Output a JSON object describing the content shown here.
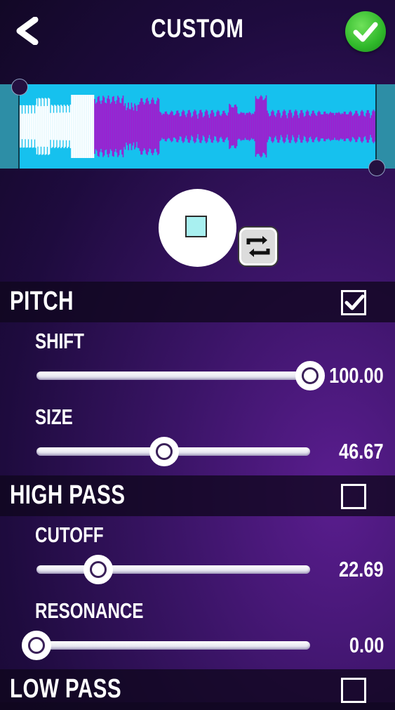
{
  "header": {
    "title": "CUSTOM",
    "back_icon": "back-arrow-icon",
    "confirm_icon": "checkmark-icon"
  },
  "waveform": {
    "background": "#16c1ee",
    "trim_color": "#2d8ea6",
    "played_color": "#ffffff",
    "selected_color": "#9b1fd0"
  },
  "player": {
    "state": "playing",
    "stop_icon": "stop-icon",
    "loop_icon": "repeat-icon"
  },
  "sections": {
    "pitch": {
      "title": "PITCH",
      "enabled": true,
      "params": [
        {
          "label": "SHIFT",
          "value": "100.00",
          "fraction": 1.0
        },
        {
          "label": "SIZE",
          "value": "46.67",
          "fraction": 0.4667
        }
      ]
    },
    "high_pass": {
      "title": "HIGH PASS",
      "enabled": false,
      "params": [
        {
          "label": "CUTOFF",
          "value": "22.69",
          "fraction": 0.2269
        },
        {
          "label": "RESONANCE",
          "value": "0.00",
          "fraction": 0.0
        }
      ]
    },
    "low_pass": {
      "title": "LOW PASS",
      "enabled": false
    }
  }
}
